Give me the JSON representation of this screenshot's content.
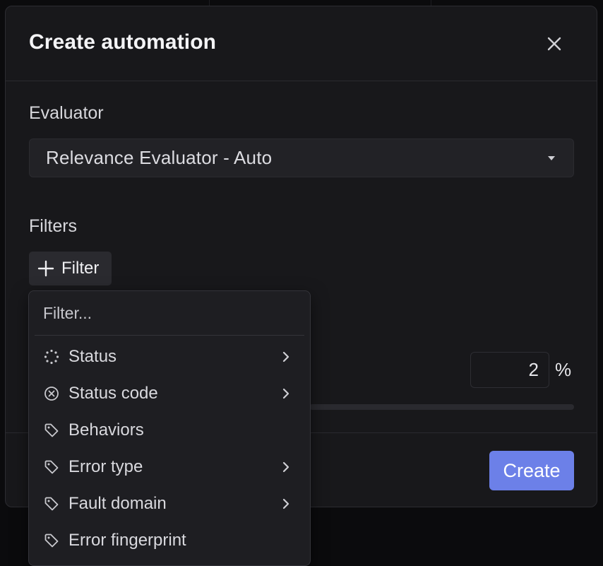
{
  "modal": {
    "title": "Create automation",
    "evaluator": {
      "label": "Evaluator",
      "selected": "Relevance Evaluator - Auto"
    },
    "filters": {
      "label": "Filters",
      "add_button_label": "Filter"
    },
    "sampling": {
      "value": "2",
      "unit": "%"
    },
    "create_label": "Create"
  },
  "dropdown": {
    "search_placeholder": "Filter...",
    "items": [
      {
        "label": "Status",
        "icon": "loading-dots-icon",
        "has_submenu": true
      },
      {
        "label": "Status code",
        "icon": "x-circle-icon",
        "has_submenu": true
      },
      {
        "label": "Behaviors",
        "icon": "tag-icon",
        "has_submenu": false
      },
      {
        "label": "Error type",
        "icon": "tag-icon",
        "has_submenu": true
      },
      {
        "label": "Fault domain",
        "icon": "tag-icon",
        "has_submenu": true
      },
      {
        "label": "Error fingerprint",
        "icon": "tag-icon",
        "has_submenu": false
      }
    ]
  },
  "colors": {
    "primary": "#6c80e8",
    "surface": "#18181b",
    "background": "#0b0b0d"
  }
}
